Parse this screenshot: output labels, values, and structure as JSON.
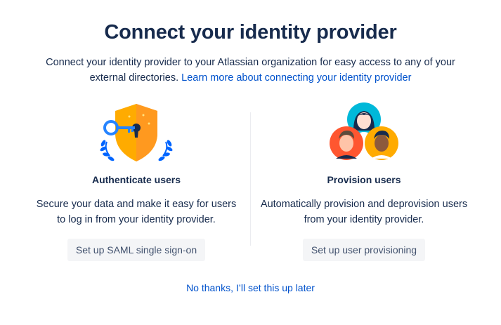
{
  "header": {
    "title": "Connect your identity provider",
    "intro_text": "Connect your identity provider to your Atlassian organization for easy access to any of your external directories.",
    "learn_more_link": "Learn more about connecting your identity provider"
  },
  "cards": {
    "authenticate": {
      "icon": "shield-key-icon",
      "title": "Authenticate users",
      "description": "Secure your data and make it easy for users to log in from your identity provider.",
      "button_label": "Set up SAML single sign-on"
    },
    "provision": {
      "icon": "users-group-icon",
      "title": "Provision users",
      "description": "Automatically provision and deprovision users from your identity provider.",
      "button_label": "Set up user provisioning"
    }
  },
  "footer": {
    "skip_link": "No thanks, I’ll set this up later"
  },
  "colors": {
    "text": "#172b4d",
    "link": "#0052cc",
    "button_bg": "#f4f5f7",
    "button_text": "#42526e",
    "shield": "#ffab00",
    "key": "#2684ff",
    "laurel": "#0065ff"
  }
}
